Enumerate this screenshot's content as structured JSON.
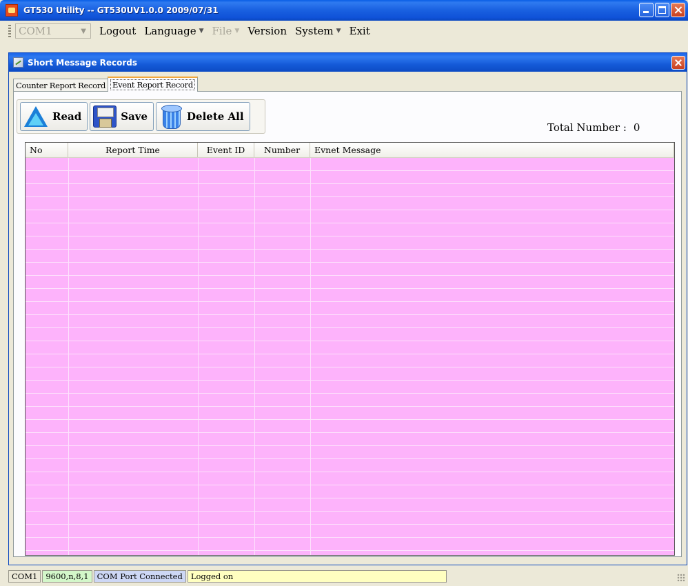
{
  "window": {
    "title": "GT530 Utility -- GT530UV1.0.0 2009/07/31"
  },
  "menubar": {
    "port_combo": "COM1",
    "items": [
      {
        "label": "Logout"
      },
      {
        "label": "Language"
      },
      {
        "label": "File"
      },
      {
        "label": "Version"
      },
      {
        "label": "System"
      },
      {
        "label": "Exit"
      }
    ]
  },
  "child": {
    "title": "Short Message Records",
    "tabs": [
      {
        "label": "Counter Report Record"
      },
      {
        "label": "Event Report Record"
      }
    ],
    "active_tab": "Event Report Record"
  },
  "toolbar": {
    "read_label": "Read",
    "save_label": "Save",
    "delete_all_label": "Delete All"
  },
  "total": {
    "label": "Total Number :",
    "value": "0"
  },
  "table": {
    "columns": [
      "No",
      "Report Time",
      "Event ID",
      "Number",
      "Evnet Message"
    ],
    "rows": []
  },
  "statusbar": {
    "port": "COM1",
    "settings": "9600,n,8,1",
    "connection": "COM Port Connected",
    "login": "Logged on"
  },
  "colors": {
    "list_background": "#fdb3fb",
    "titlebar": "#0a5ee6"
  }
}
